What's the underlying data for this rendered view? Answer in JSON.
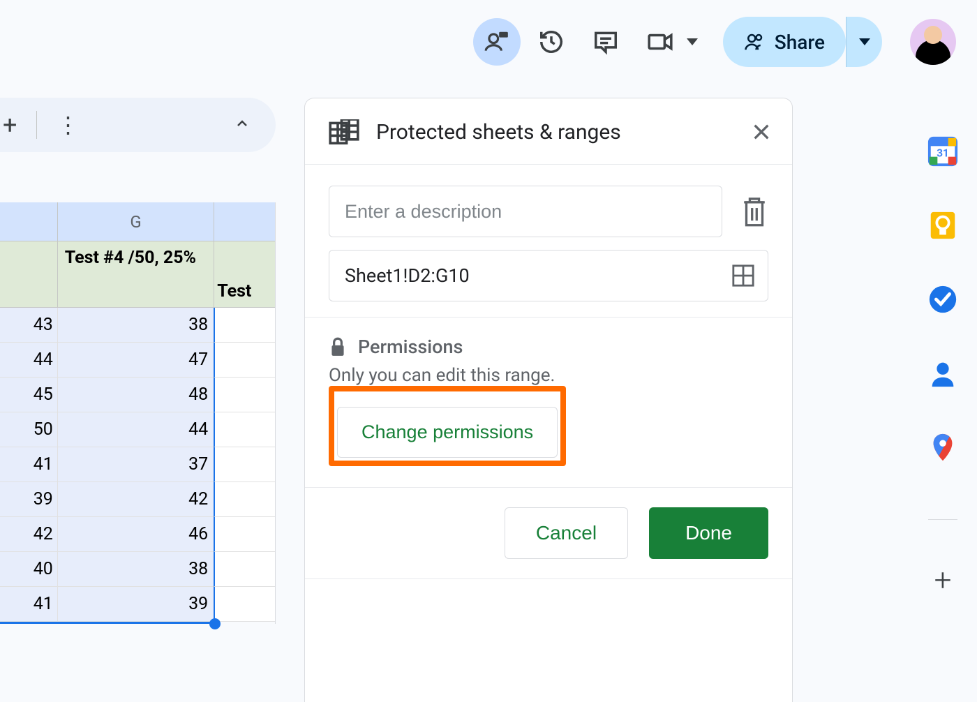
{
  "toolbar": {
    "share_label": "Share"
  },
  "sheet": {
    "column_g_header": "G",
    "row_header_g": "Test #4 /50, 25%",
    "row_header_h": "Test",
    "data": [
      {
        "f": "43",
        "g": "38"
      },
      {
        "f": "44",
        "g": "47"
      },
      {
        "f": "45",
        "g": "48"
      },
      {
        "f": "50",
        "g": "44"
      },
      {
        "f": "41",
        "g": "37"
      },
      {
        "f": "39",
        "g": "42"
      },
      {
        "f": "42",
        "g": "46"
      },
      {
        "f": "40",
        "g": "38"
      },
      {
        "f": "41",
        "g": "39"
      }
    ]
  },
  "panel": {
    "title": "Protected sheets & ranges",
    "description_placeholder": "Enter a description",
    "range_value": "Sheet1!D2:G10",
    "permissions_label": "Permissions",
    "permissions_sub": "Only you can edit this range.",
    "change_permissions_label": "Change permissions",
    "cancel_label": "Cancel",
    "done_label": "Done"
  }
}
